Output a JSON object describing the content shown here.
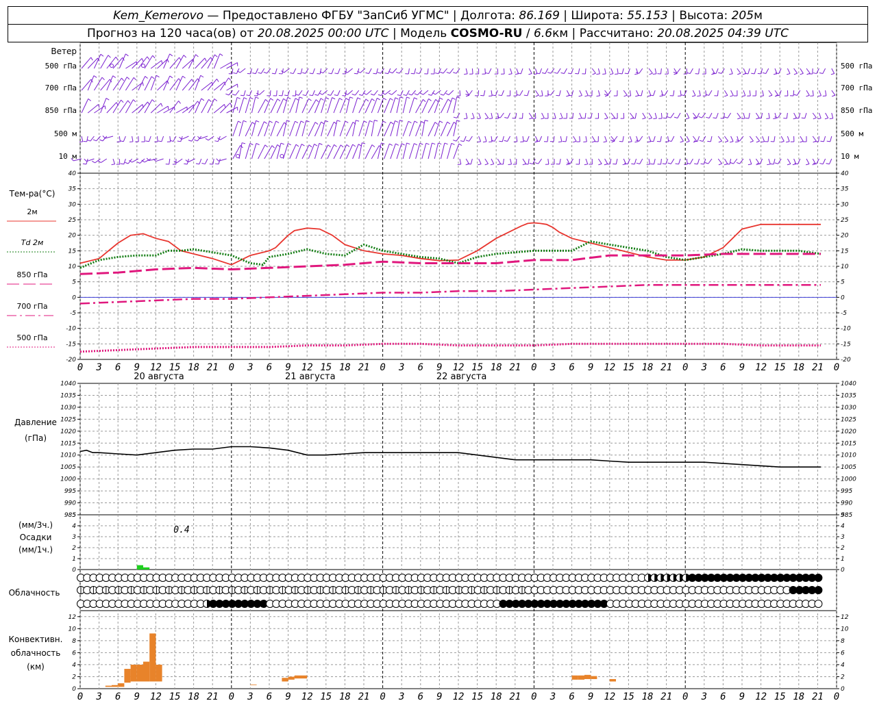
{
  "header": {
    "line1": {
      "station": "Kem_Kemerovo",
      "provider": " — Предоставлено ФГБУ \"ЗапСиб УГМС\" | Долгота: ",
      "lon": "86.169",
      "lat_label": " | Широта: ",
      "lat": "55.153",
      "alt_label": " | Высота: ",
      "alt": "205",
      "alt_unit": "м"
    },
    "line2": {
      "p1": "Прогноз на 120 часа(ов) от ",
      "run": "20.08.2025 00:00 UTC",
      "p2": "  | Модель ",
      "model": "COSMO-RU",
      "p3": " / ",
      "res": "6.6",
      "res_unit": "км",
      "p4": " | Рассчитано: ",
      "calc": "20.08.2025 04:39 UTC"
    }
  },
  "labels": {
    "wind": "Ветер",
    "wind_levels": [
      "500 гПа",
      "700 гПа",
      "850 гПа",
      "500 м",
      "10  м"
    ],
    "temp": "Тем-ра(°С)",
    "temp_legend": [
      "2м",
      "Td  2м",
      "850 гПа",
      "700 гПа",
      "500 гПа"
    ],
    "pressure": "Давление",
    "pressure_unit": "(гПа)",
    "precip_lines": [
      "(мм/3ч.)",
      "Осадки",
      "(мм/1ч.)"
    ],
    "precip_annotation": "0.4",
    "cloud": "Облачность",
    "conv_lines": [
      "Конвективн.",
      "облачность",
      "(км)"
    ],
    "dates": [
      "20 августа",
      "21 августа",
      "22 августа"
    ],
    "hour_ticks": [
      "0",
      "3",
      "6",
      "9",
      "12",
      "15",
      "18",
      "21"
    ]
  },
  "colors": {
    "t2m": "#e8352e",
    "td2m": "#137d13",
    "t850": "#e0177d",
    "t700": "#e0177d",
    "t500": "#e0177d",
    "wind": "#7a1fd0",
    "precip": "#1fcf1f",
    "conv": "#e8832a",
    "grid": "#999999"
  },
  "chart_data": [
    {
      "type": "line",
      "title": "Тем-ра(°С)",
      "x_unit": "hours from 20.08.2025 00:00 UTC",
      "ylim": [
        -20,
        40
      ],
      "yticks": [
        -20,
        -15,
        -10,
        -5,
        0,
        5,
        10,
        15,
        20,
        25,
        30,
        35,
        40
      ],
      "series": [
        {
          "name": "2м",
          "style": "solid",
          "x": [
            0,
            3,
            6,
            8,
            10,
            12,
            14,
            16,
            18,
            21,
            24,
            27,
            29,
            30,
            31,
            32,
            33,
            34,
            36,
            38,
            40,
            42,
            45,
            48,
            51,
            54,
            57,
            60,
            63,
            66,
            69,
            70,
            71,
            72,
            73,
            74,
            75,
            76,
            78,
            80,
            84,
            88,
            90,
            93,
            96,
            99,
            102,
            105,
            108,
            111,
            114,
            117,
            117.5
          ],
          "y": [
            11,
            12.5,
            17.5,
            20,
            20.5,
            19,
            18,
            15,
            14,
            12.5,
            10.5,
            13.5,
            14.5,
            15,
            16,
            18,
            20,
            21.5,
            22.3,
            22,
            20,
            17,
            15,
            14,
            13.5,
            12.5,
            11.8,
            12,
            15,
            19,
            22,
            23,
            23.8,
            24,
            23.8,
            23.5,
            22.5,
            21,
            19,
            18,
            16,
            14,
            13,
            12,
            12,
            13,
            16,
            22,
            23.5,
            23.5,
            23.5,
            23.5,
            23.5
          ]
        },
        {
          "name": "Td  2м",
          "style": "dotted",
          "x": [
            0,
            3,
            6,
            9,
            12,
            14,
            16,
            18,
            21,
            24,
            27,
            29,
            30,
            33,
            35,
            36,
            39,
            42,
            45,
            48,
            51,
            54,
            57,
            60,
            63,
            66,
            69,
            72,
            75,
            78,
            81,
            84,
            87,
            90,
            93,
            96,
            99,
            102,
            105,
            108,
            111,
            114,
            117.5
          ],
          "y": [
            9.5,
            12,
            13,
            13.5,
            13.5,
            15,
            15,
            15.5,
            14.5,
            13.5,
            11,
            10.5,
            13,
            14,
            15,
            15.5,
            14,
            13.5,
            17,
            15,
            14,
            13,
            12.5,
            11,
            13,
            14,
            14.5,
            15,
            15,
            15,
            18,
            17,
            16,
            15,
            13,
            12,
            13,
            14,
            15.5,
            15,
            15,
            15,
            14
          ]
        },
        {
          "name": "850 гПа",
          "style": "dashed",
          "x": [
            0,
            6,
            12,
            18,
            24,
            30,
            36,
            42,
            48,
            54,
            60,
            66,
            72,
            78,
            84,
            90,
            96,
            102,
            108,
            114,
            117.5
          ],
          "y": [
            7.5,
            8,
            9,
            9.5,
            9,
            9.5,
            10,
            10.5,
            11.5,
            11,
            11,
            11,
            12,
            12,
            13.5,
            13.5,
            13.5,
            14,
            14,
            14,
            14
          ]
        },
        {
          "name": "700 гПа",
          "style": "dashdot",
          "x": [
            0,
            6,
            12,
            18,
            24,
            30,
            36,
            42,
            48,
            54,
            60,
            66,
            72,
            78,
            84,
            90,
            96,
            102,
            108,
            114,
            117.5
          ],
          "y": [
            -2,
            -1.5,
            -1,
            -0.5,
            -0.5,
            0,
            0.5,
            1,
            1.5,
            1.5,
            2,
            2,
            2.5,
            3,
            3.5,
            4,
            4,
            4,
            4,
            4,
            4
          ]
        },
        {
          "name": "500 гПа",
          "style": "dotted",
          "x": [
            0,
            6,
            12,
            18,
            24,
            30,
            36,
            42,
            48,
            54,
            60,
            66,
            72,
            78,
            84,
            90,
            96,
            102,
            108,
            114,
            117.5
          ],
          "y": [
            -17.5,
            -17,
            -16.5,
            -16,
            -16,
            -16,
            -15.5,
            -15.5,
            -15,
            -15,
            -15.5,
            -15.5,
            -15.5,
            -15,
            -15,
            -15,
            -15,
            -15,
            -15.5,
            -15.5,
            -15.5
          ]
        }
      ]
    },
    {
      "type": "line",
      "title": "Давление",
      "ylabel": "(гПа)",
      "ylim": [
        985,
        1040
      ],
      "yticks": [
        985,
        990,
        995,
        1000,
        1005,
        1010,
        1015,
        1020,
        1025,
        1030,
        1035,
        1040
      ],
      "series": [
        {
          "name": "Давление",
          "x": [
            0,
            1,
            2,
            3,
            6,
            9,
            12,
            15,
            18,
            21,
            24,
            27,
            30,
            33,
            36,
            39,
            42,
            45,
            48,
            51,
            54,
            57,
            60,
            63,
            66,
            69,
            72,
            75,
            78,
            81,
            84,
            87,
            90,
            93,
            96,
            99,
            102,
            105,
            108,
            111,
            114,
            117.5
          ],
          "y": [
            1011.5,
            1012,
            1011,
            1011,
            1010.5,
            1010,
            1011,
            1012,
            1012.5,
            1012.5,
            1013.5,
            1013.5,
            1013,
            1012,
            1010,
            1010,
            1010.5,
            1011,
            1011,
            1011,
            1011,
            1011,
            1011,
            1010,
            1009,
            1008,
            1008,
            1008,
            1008,
            1008,
            1007.5,
            1007,
            1007,
            1007,
            1007,
            1007,
            1006.5,
            1006,
            1005.5,
            1005,
            1005,
            1005
          ]
        }
      ]
    },
    {
      "type": "bar",
      "title": "Осадки",
      "ylim": [
        0,
        5
      ],
      "yticks": [
        0,
        1,
        2,
        3,
        4,
        5
      ],
      "series": [
        {
          "name": "мм/3ч.",
          "x": [
            9,
            10
          ],
          "values": [
            0.4,
            0.2
          ]
        }
      ]
    },
    {
      "type": "table",
      "title": "Облачность",
      "rows": [
        "upper",
        "middle",
        "lower"
      ],
      "x_unit": "hours",
      "upper": {
        "overcast": [
          [
            97,
            117.5
          ]
        ],
        "partial": [
          [
            90,
            96
          ]
        ]
      },
      "middle": {
        "overcast": [
          [
            113,
            117.5
          ]
        ],
        "partial": []
      },
      "lower": {
        "overcast": [
          [
            21,
            29
          ],
          [
            67,
            83
          ]
        ],
        "partial": [
          [
            20,
            21
          ]
        ]
      }
    },
    {
      "type": "bar",
      "title": "Конвективн. облачность",
      "ylabel": "(км)",
      "ylim": [
        0,
        13
      ],
      "yticks": [
        0,
        2,
        4,
        6,
        8,
        10,
        12
      ],
      "series": [
        {
          "name": "conv",
          "bars": [
            {
              "x": 4,
              "bottom": 0.3,
              "top": 0.5
            },
            {
              "x": 5,
              "bottom": 0.3,
              "top": 0.6
            },
            {
              "x": 6,
              "bottom": 0.3,
              "top": 0.9
            },
            {
              "x": 7,
              "bottom": 1.0,
              "top": 3.3
            },
            {
              "x": 8,
              "bottom": 1.2,
              "top": 4.0
            },
            {
              "x": 9,
              "bottom": 1.2,
              "top": 4.0
            },
            {
              "x": 10,
              "bottom": 1.2,
              "top": 4.5
            },
            {
              "x": 11,
              "bottom": 1.2,
              "top": 9.2
            },
            {
              "x": 12,
              "bottom": 1.2,
              "top": 4.0
            },
            {
              "x": 27,
              "bottom": 0.6,
              "top": 0.7
            },
            {
              "x": 32,
              "bottom": 1.2,
              "top": 1.8
            },
            {
              "x": 33,
              "bottom": 1.5,
              "top": 2.0
            },
            {
              "x": 34,
              "bottom": 1.7,
              "top": 2.2
            },
            {
              "x": 35,
              "bottom": 1.7,
              "top": 2.2
            },
            {
              "x": 78,
              "bottom": 1.5,
              "top": 2.2
            },
            {
              "x": 79,
              "bottom": 1.5,
              "top": 2.2
            },
            {
              "x": 80,
              "bottom": 1.6,
              "top": 2.3
            },
            {
              "x": 81,
              "bottom": 1.6,
              "top": 2.1
            },
            {
              "x": 84,
              "bottom": 1.2,
              "top": 1.6
            }
          ]
        }
      ]
    },
    {
      "type": "table",
      "title": "Ветер",
      "levels": [
        "500 гПа",
        "700 гПа",
        "850 гПа",
        "500 м",
        "10  м"
      ],
      "calm_markers": [
        {
          "level": "500 гПа",
          "x": [
            5,
            10
          ]
        },
        {
          "level": "10  м",
          "x": [
            25,
            32
          ]
        }
      ]
    }
  ]
}
